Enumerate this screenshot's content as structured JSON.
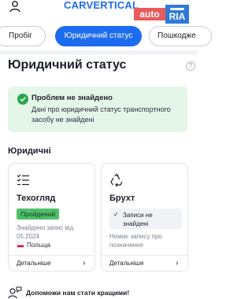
{
  "header": {
    "logo": "CARVERTICAL",
    "ria_auto": "auto",
    "ria_brand": "RIA"
  },
  "tabs": [
    {
      "label": "Пробіг"
    },
    {
      "label": "Юридичний статус"
    },
    {
      "label": "Пошкодже"
    }
  ],
  "section": {
    "title": "Юридичний статус",
    "help_symbol": "?"
  },
  "alert": {
    "title": "Проблем не знайдено",
    "text": "Дані про юридичний статус транспортного засобу не знайдені"
  },
  "legal": {
    "label": "Юридичні",
    "cards": [
      {
        "title": "Техогляд",
        "badge": "Пройдений",
        "found_text": "Знайдено запис від 05.2024",
        "country": "Польща",
        "details": "Детальніше"
      },
      {
        "title": "Брухт",
        "records_text": "Записи не знайдені",
        "no_record": "Немає запису про позначення",
        "details": "Детальніше"
      }
    ]
  },
  "feedback": {
    "text": "Допоможи нам стати кращими!"
  },
  "colors": {
    "accent": "#1d6cf0",
    "success_bg": "#e3f6e8",
    "success": "#2aa84a",
    "badge": "#4fbf6a",
    "ria_red": "#e85b5b",
    "ria_blue": "#2f7ad8"
  }
}
